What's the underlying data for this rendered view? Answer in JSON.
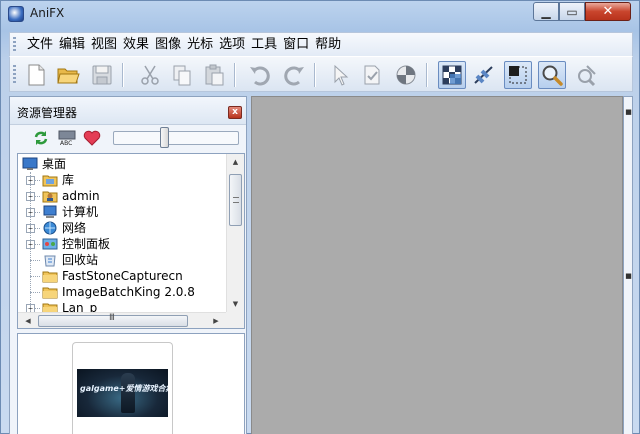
{
  "window": {
    "title": "AniFX"
  },
  "menu": {
    "items": [
      "文件",
      "编辑",
      "视图",
      "效果",
      "图像",
      "光标",
      "选项",
      "工具",
      "窗口",
      "帮助"
    ]
  },
  "toolbar": {
    "buttons": [
      {
        "icon": "new-file-icon"
      },
      {
        "icon": "open-folder-icon"
      },
      {
        "icon": "save-icon"
      },
      {
        "icon": "cut-icon"
      },
      {
        "icon": "copy-icon"
      },
      {
        "icon": "paste-icon"
      },
      {
        "icon": "undo-icon"
      },
      {
        "icon": "redo-icon"
      },
      {
        "icon": "pointer-icon"
      },
      {
        "icon": "check-doc-icon"
      },
      {
        "icon": "circle-split-icon"
      },
      {
        "icon": "transparency-grid-icon",
        "active": true
      },
      {
        "icon": "hotspot-icon"
      },
      {
        "icon": "selection-frame-icon",
        "active": true
      },
      {
        "icon": "zoom-icon",
        "active": true
      },
      {
        "icon": "preview-icon"
      }
    ]
  },
  "explorer": {
    "title": "资源管理器",
    "close_glyph": "x",
    "tree": [
      {
        "label": "桌面",
        "icon": "desktop-icon",
        "level": 0,
        "expander": ""
      },
      {
        "label": "库",
        "icon": "library-folder-icon",
        "level": 1,
        "expander": "+"
      },
      {
        "label": "admin",
        "icon": "user-folder-icon",
        "level": 1,
        "expander": "+"
      },
      {
        "label": "计算机",
        "icon": "computer-icon",
        "level": 1,
        "expander": "+"
      },
      {
        "label": "网络",
        "icon": "network-icon",
        "level": 1,
        "expander": "+"
      },
      {
        "label": "控制面板",
        "icon": "control-panel-icon",
        "level": 1,
        "expander": "+"
      },
      {
        "label": "回收站",
        "icon": "recycle-bin-icon",
        "level": 1,
        "expander": ""
      },
      {
        "label": "FastStoneCapturecn",
        "icon": "folder-icon",
        "level": 1,
        "expander": ""
      },
      {
        "label": "ImageBatchKing 2.0.8",
        "icon": "folder-icon",
        "level": 1,
        "expander": ""
      },
      {
        "label": "Lan_p",
        "icon": "folder-icon",
        "level": 1,
        "expander": "+"
      }
    ],
    "hscroll_grip": "III",
    "preview_text": "galgame+爱情游戏合集"
  },
  "colors": {
    "workspace": "#ababab",
    "title_gradient_top": "#bcd3ee",
    "close_red": "#c9452d"
  }
}
